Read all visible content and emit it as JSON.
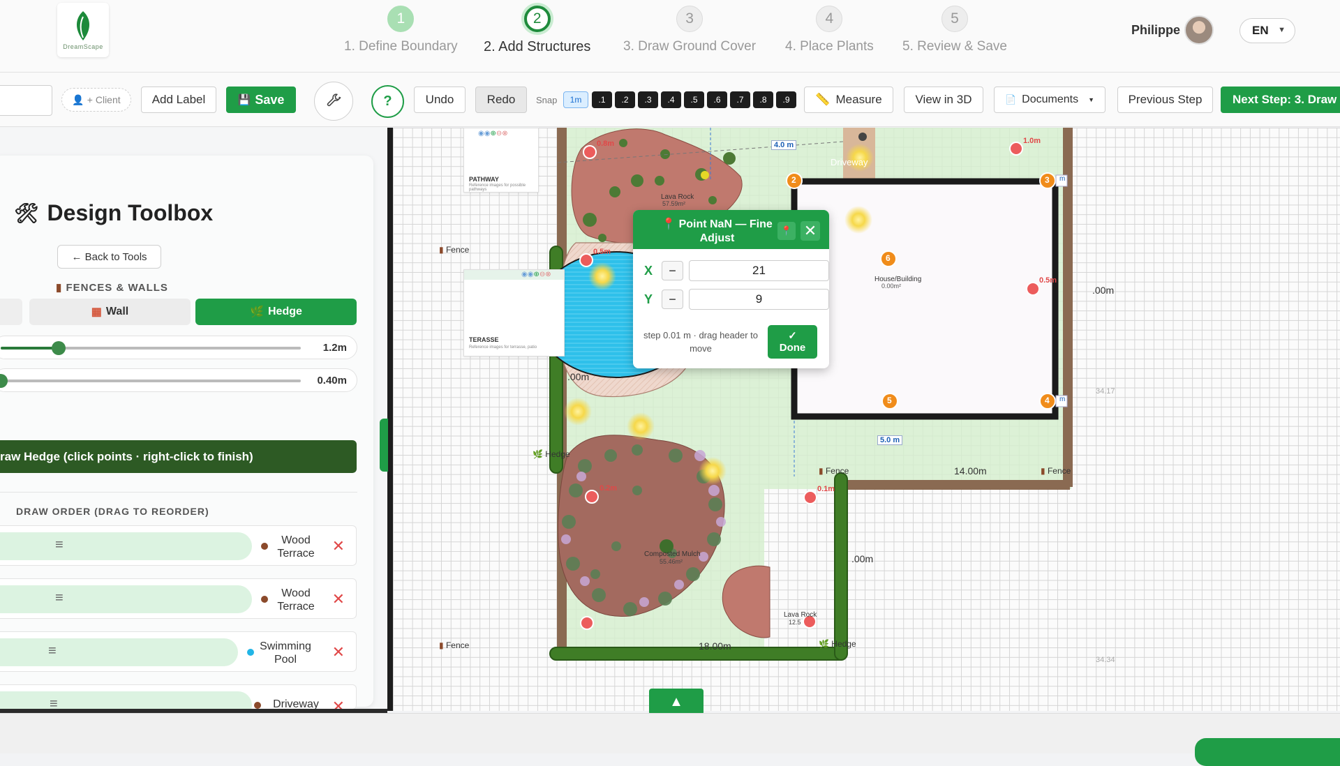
{
  "app": {
    "logo_text": "DreamScape"
  },
  "steps": [
    {
      "number": "1",
      "label": "1. Define Boundary"
    },
    {
      "number": "2",
      "label": "2. Add Structures"
    },
    {
      "number": "3",
      "label": "3. Draw Ground Cover"
    },
    {
      "number": "4",
      "label": "4. Place Plants"
    },
    {
      "number": "5",
      "label": "5. Review & Save"
    }
  ],
  "user": {
    "name": "Philippe",
    "language": "EN"
  },
  "toolbar": {
    "client": "+ Client",
    "add_label": "Add Label",
    "save": "Save",
    "help": "?",
    "undo": "Undo",
    "redo": "Redo",
    "snap_label": "Snap",
    "snap_options": [
      "1m",
      ".1",
      ".2",
      ".3",
      ".4",
      ".5",
      ".6",
      ".7",
      ".8",
      ".9"
    ],
    "measure": "Measure",
    "view3d": "View in 3D",
    "documents": "Documents",
    "previous": "Previous Step",
    "next": "Next Step: 3. Draw"
  },
  "sidebar": {
    "title": "Design Toolbox",
    "back": "← Back to Tools",
    "section": "FENCES & WALLS",
    "options": {
      "wall": "Wall",
      "hedge": "Hedge"
    },
    "height_value": "1.2m",
    "width_value": "0.40m",
    "draw_button": "raw Hedge (click points · right-click to finish)",
    "draw_order_title": "DRAW ORDER (DRAG TO REORDER)",
    "order_items": [
      {
        "name": "Wood Terrace",
        "color": "#8b4a2b"
      },
      {
        "name": "Wood Terrace",
        "color": "#8b4a2b"
      },
      {
        "name": "Swimming Pool",
        "color": "#22b5e6"
      },
      {
        "name": "Driveway",
        "color": "#8b4a2b"
      }
    ]
  },
  "canvas": {
    "labels": {
      "dim_4m": "4.0 m",
      "dim_5m": "5.0 m",
      "dim_14m": "14.00m",
      "dim_10m_a": ".00m",
      "dim_10m_b": ".00m",
      "dim_10m_c": ".00m",
      "dim_18m": "18.00m",
      "house": "House/Building",
      "house_area": "0.00m²",
      "lava_rock": "Lava Rock",
      "lava_rock_area": "57.59m²",
      "lava_rock_small": "Lava Rock",
      "lava_rock_small_area": "12.5",
      "mulch": "Composted Mulch",
      "mulch_area": "55.46m²",
      "driveway": "Driveway",
      "fence_1": "Fence",
      "fence_2": "Fence",
      "fence_3": "Fence",
      "fence_4": "Fence",
      "hedge_1": "Hedge",
      "hedge_2": "Hedge",
      "coord_1": "34.17",
      "coord_2": "34.34",
      "m_tag_1": "m",
      "m_tag_2": "m",
      "red_1": "0.8m",
      "red_2": "1.0m",
      "red_3": "0.5m",
      "red_4": "0.5m",
      "red_5": "0.2m",
      "red_6": "0.1m"
    },
    "points": [
      "2",
      "3",
      "4",
      "5",
      "6"
    ],
    "ref_cards": [
      {
        "title": "PATHWAY",
        "subtitle": "Reference images for possible pathways"
      },
      {
        "title": "TERASSE",
        "subtitle": "Reference images for terrasse, patio"
      }
    ]
  },
  "popup": {
    "title": "Point NaN — Fine Adjust",
    "x_label": "X",
    "y_label": "Y",
    "x_value": "21",
    "y_value": "9",
    "hint": "step 0.01 m · drag header to move",
    "done": "Done"
  }
}
